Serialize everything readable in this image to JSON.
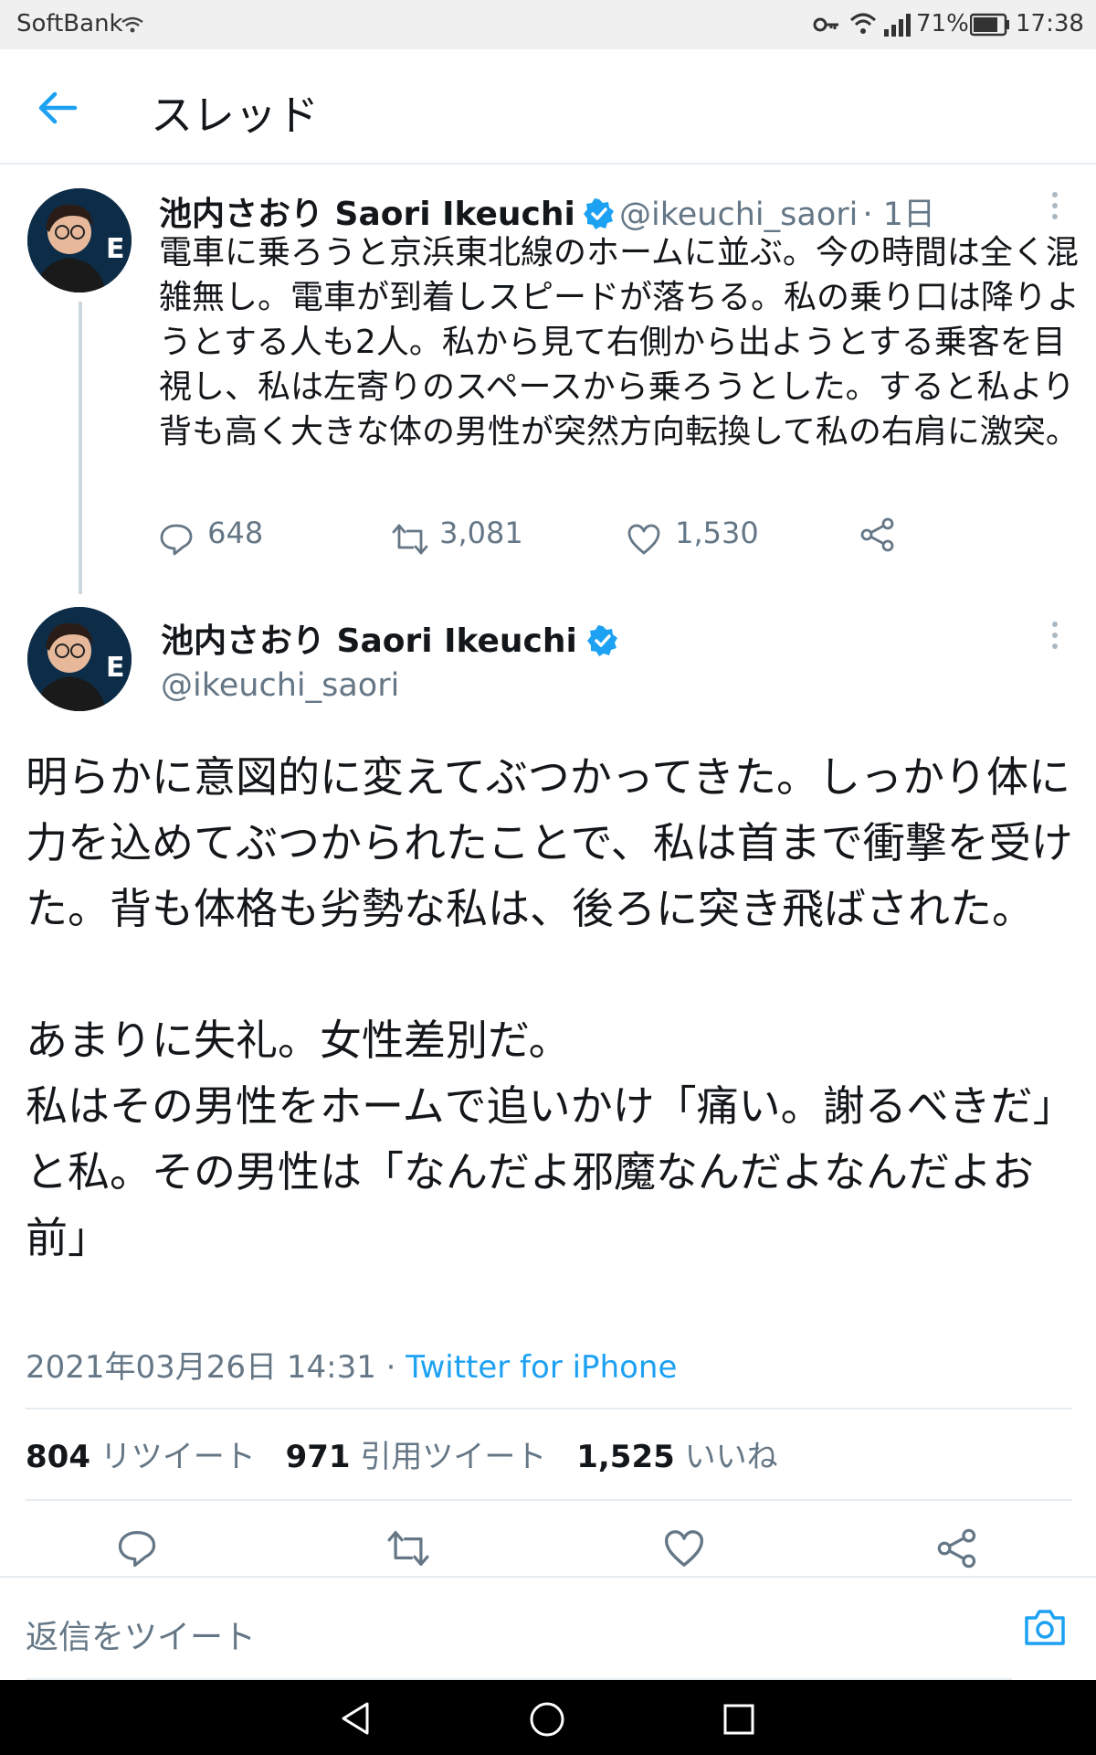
{
  "status_bar": {
    "carrier": "SoftBank",
    "battery": "71%",
    "time": "17:38"
  },
  "header": {
    "title": "スレッド"
  },
  "parent_tweet": {
    "name": "池内さおり Saori Ikeuchi",
    "handle": "@ikeuchi_saori",
    "time": "· 1日",
    "text": "電車に乗ろうと京浜東北線のホームに並ぶ。今の時間は全く混雑無し。電車が到着しスピードが落ちる。私の乗り口は降りようとする人も2人。私から見て右側から出ようとする乗客を目視し、私は左寄りのスペースから乗ろうとした。すると私より背も高く大きな体の男性が突然方向転換して私の右肩に激突。",
    "replies": "648",
    "retweets": "3,081",
    "likes": "1,530"
  },
  "main_tweet": {
    "name": "池内さおり Saori Ikeuchi",
    "handle": "@ikeuchi_saori",
    "text": "明らかに意図的に変えてぶつかってきた。しっかり体に力を込めてぶつかられたことで、私は首まで衝撃を受けた。背も体格も劣勢な私は、後ろに突き飛ばされた。\n\nあまりに失礼。女性差別だ。\n私はその男性をホームで追いかけ「痛い。謝るべきだ」と私。その男性は「なんだよ邪魔なんだよなんだよお前」",
    "timestamp": "2021年03月26日 14:31",
    "separator": "·",
    "source": "Twitter for iPhone",
    "stats": {
      "retweets_count": "804",
      "retweets_label": "リツイート",
      "quotes_count": "971",
      "quotes_label": "引用ツイート",
      "likes_count": "1,525",
      "likes_label": "いいね"
    }
  },
  "reply_bar": {
    "placeholder": "返信をツイート"
  },
  "colors": {
    "accent": "#1da1f2",
    "muted": "#657786",
    "text": "#14171a",
    "divider": "#e6ecf0"
  },
  "icons": [
    "back-arrow-icon",
    "wifi-icon",
    "key-icon",
    "signal-icon",
    "battery-icon",
    "verified-badge-icon",
    "more-icon",
    "reply-icon",
    "retweet-icon",
    "like-icon",
    "share-icon",
    "camera-icon",
    "nav-back-icon",
    "nav-home-icon",
    "nav-recents-icon"
  ]
}
